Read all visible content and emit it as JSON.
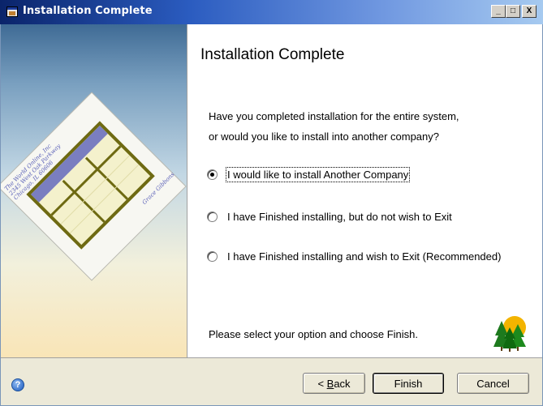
{
  "window": {
    "title": "Installation Complete",
    "icon": "installer-window-icon",
    "caption_buttons": {
      "minimize": "_",
      "maximize": "□",
      "close": "X"
    }
  },
  "side_image": {
    "card_lines": [
      "The World Online, Inc",
      "2345 West Oak Parkway",
      "Chicago, IL 60606"
    ],
    "signature": "Grace Gibbons"
  },
  "content": {
    "heading": "Installation Complete",
    "question_line1": "Have you completed installation for the entire system,",
    "question_line2": "or would you like to install into another company?",
    "options": [
      {
        "label": "I would like to install Another Company",
        "selected": true
      },
      {
        "label": "I have Finished installing, but do not wish to Exit",
        "selected": false
      },
      {
        "label": "I have Finished installing and wish to Exit (Recommended)",
        "selected": false
      }
    ],
    "footer": "Please select your option and choose Finish.",
    "footer_icon": "trees-icon"
  },
  "buttons": {
    "help_icon": "help-icon",
    "back_prefix": "< ",
    "back_accel": "B",
    "back_rest": "ack",
    "finish": "Finish",
    "cancel": "Cancel"
  },
  "colors": {
    "titlebar_start": "#0a246a",
    "titlebar_end": "#a6caf0",
    "button_face": "#ece9d8"
  }
}
